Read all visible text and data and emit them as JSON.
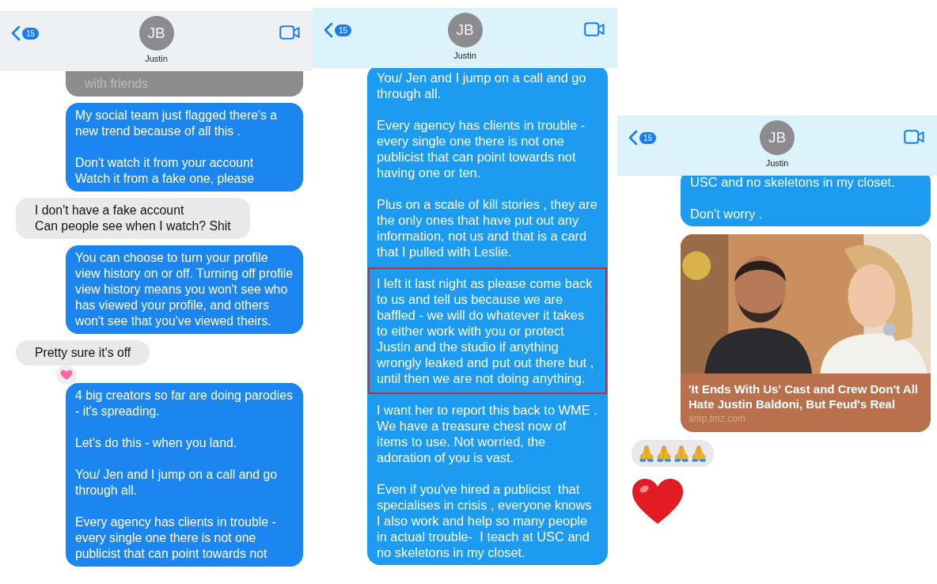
{
  "panels": [
    {
      "header": {
        "back_badge": "15",
        "avatar_initials": "JB",
        "contact_name": "Justin"
      },
      "messages": [
        {
          "kind": "received",
          "faded": true,
          "tapback": false,
          "paragraphs": [
            {
              "text": "with friends",
              "highlighted": false
            }
          ]
        },
        {
          "kind": "sent",
          "faded": false,
          "tapback": false,
          "paragraphs": [
            {
              "text": "My social team just flagged there's a new trend because of all this .",
              "highlighted": false
            },
            {
              "text": "Don't watch it from your account\nWatch it from a fake one, please",
              "highlighted": false
            }
          ]
        },
        {
          "kind": "received",
          "faded": false,
          "tapback": false,
          "paragraphs": [
            {
              "text": "I don't have a fake account\nCan people see when I watch? Shit",
              "highlighted": false
            }
          ]
        },
        {
          "kind": "sent",
          "faded": false,
          "tapback": false,
          "paragraphs": [
            {
              "text": "You can choose to turn your profile view history on or off. Turning off profile view history means you won't see who has viewed your profile, and others won't see that you've viewed theirs.",
              "highlighted": false
            }
          ]
        },
        {
          "kind": "received",
          "faded": false,
          "tapback": false,
          "paragraphs": [
            {
              "text": "Pretty sure it's off",
              "highlighted": false
            }
          ]
        },
        {
          "kind": "sent",
          "faded": false,
          "tapback": true,
          "paragraphs": [
            {
              "text": "4 big creators so far are doing parodies - it's spreading.",
              "highlighted": false
            },
            {
              "text": "Let's do this - when you land.",
              "highlighted": false
            },
            {
              "text": "You/ Jen and I jump on a call and go through all.",
              "highlighted": false
            },
            {
              "text": "Every agency has clients in trouble - every single one there is not one publicist that can point towards not",
              "highlighted": false
            }
          ]
        }
      ]
    },
    {
      "header": {
        "back_badge": "15",
        "avatar_initials": "JB",
        "contact_name": "Justin"
      },
      "messages": [
        {
          "kind": "sent",
          "faded": false,
          "tapback": false,
          "paragraphs": [
            {
              "text": "You/ Jen and I jump on a call and go through all.",
              "highlighted": false
            },
            {
              "text": "Every agency has clients in trouble - every single one there is not one publicist that can point towards not having one or ten.",
              "highlighted": false
            },
            {
              "text": "Plus on a scale of kill stories , they are the only ones that have put out any information, not us and that is a card that I pulled with Leslie.",
              "highlighted": false
            },
            {
              "text": "I left it last night as please come back to us and tell us because we are baffled - we will do whatever it takes to either work with you or protect Justin and the studio if anything wrongly leaked and put out there but , until then we are not doing anything.",
              "highlighted": true
            },
            {
              "text": "I want her to report this back to WME . We have a treasure chest now of items to use. Not worried, the adoration of you is vast.",
              "highlighted": false
            },
            {
              "text": "Even if you've hired a publicist  that specialises in crisis , everyone knows I also work and help so many people in actual trouble-  I teach at USC and no skeletons in my closet.",
              "highlighted": false
            }
          ]
        }
      ]
    },
    {
      "header": {
        "back_badge": "15",
        "avatar_initials": "JB",
        "contact_name": "Justin"
      },
      "messages": [
        {
          "kind": "sent",
          "faded": false,
          "tapback": false,
          "paragraphs": [
            {
              "text": "USC and no skeletons in my closet.",
              "highlighted": false
            },
            {
              "text": "Don't worry .",
              "highlighted": false
            }
          ]
        },
        {
          "kind": "link",
          "title": "'It Ends With Us' Cast and Crew Don't All Hate Justin Baldoni, But Feud's Real",
          "domain": "amp.tmz.com"
        },
        {
          "kind": "emoji",
          "emojis": [
            {
              "kind": "praying-hands"
            },
            {
              "kind": "praying-hands"
            },
            {
              "kind": "praying-hands"
            },
            {
              "kind": "praying-hands"
            }
          ]
        },
        {
          "kind": "heart"
        }
      ]
    }
  ]
}
